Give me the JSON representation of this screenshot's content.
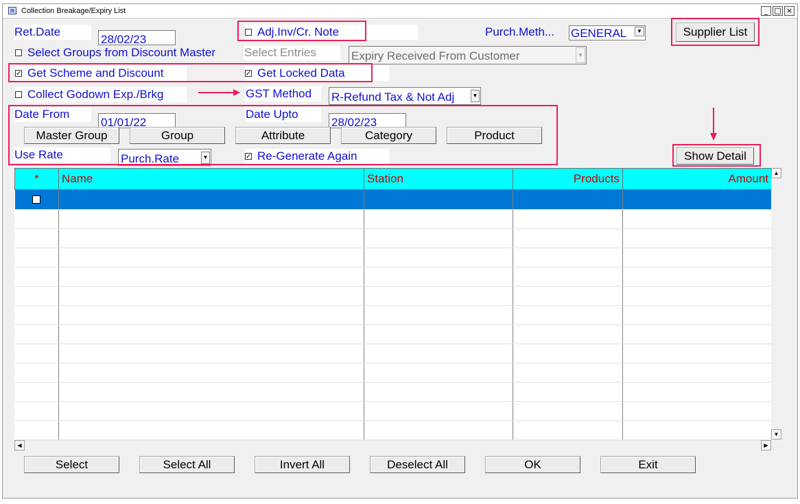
{
  "window": {
    "title": "Collection Breakage/Expiry List",
    "min_label": "_",
    "max_label": "□",
    "close_label": "×"
  },
  "form": {
    "ret_date_label": "Ret.Date",
    "ret_date_value": "28/02/23",
    "adj_inv_label": "Adj.Inv/Cr. Note",
    "adj_inv_checked": false,
    "purch_meth_label": "Purch.Meth...",
    "purch_meth_value": "GENERAL",
    "supplier_list_button": "Supplier List",
    "select_groups_label": "Select Groups from Discount Master",
    "select_groups_checked": false,
    "select_entries_label": "Select Entries",
    "select_entries_value": "Expiry Received From Customer",
    "get_scheme_label": "Get Scheme and Discount",
    "get_scheme_checked": true,
    "get_locked_label": "Get Locked Data",
    "get_locked_checked": true,
    "collect_godown_label": "Collect Godown Exp./Brkg",
    "collect_godown_checked": false,
    "gst_method_label": "GST Method",
    "gst_method_value": "R-Refund Tax & Not Adj",
    "date_from_label": "Date From",
    "date_from_value": "01/01/22",
    "date_upto_label": "Date Upto",
    "date_upto_value": "28/02/23",
    "filter_buttons": [
      "Master Group",
      "Group",
      "Attribute",
      "Category",
      "Product"
    ],
    "use_rate_label": "Use Rate",
    "use_rate_value": "Purch.Rate",
    "regenerate_label": "Re-Generate Again",
    "regenerate_checked": true,
    "show_detail_button": "Show Detail"
  },
  "grid": {
    "columns": [
      "*",
      "Name",
      "Station",
      "Products",
      "Amount"
    ],
    "rows": 13,
    "selected_row": 0
  },
  "bottom_buttons": [
    "Select",
    "Select All",
    "Invert All",
    "Deselect All",
    "OK",
    "Exit"
  ],
  "colors": {
    "label_blue": "#1010d0",
    "grid_header": "#00ffff",
    "grid_header_text": "#c80000",
    "selection": "#0078d7",
    "highlight": "#ec1e5a"
  }
}
